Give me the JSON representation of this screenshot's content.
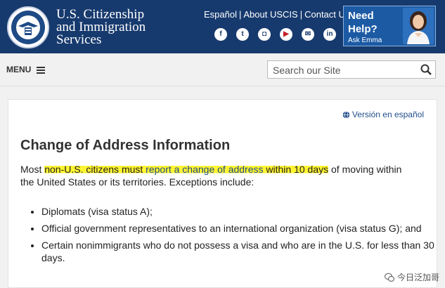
{
  "header": {
    "agency_lines": [
      "U.S. Citizenship",
      "and Immigration",
      "Services"
    ],
    "top_links": [
      "Español",
      "About USCIS",
      "Contact Us"
    ],
    "social_icons": [
      "facebook-icon",
      "twitter-icon",
      "instagram-icon",
      "youtube-icon",
      "email-icon",
      "linkedin-icon"
    ],
    "need_help": {
      "line1": "Need",
      "line2": "Help?",
      "line3": "Ask Emma"
    },
    "colors": {
      "navy": "#173a6e",
      "help_blue": "#1c5aa4"
    }
  },
  "menubar": {
    "menu_label": "MENU",
    "search_placeholder": "Search our Site"
  },
  "content": {
    "spanish_link": "Versión en español",
    "title": "Change of Address Information",
    "intro": {
      "part1": "Most ",
      "hl1": "non-U.S. citizens must ",
      "hl_link": "report a change of address",
      "hl2": " within 10 days",
      "part2": " of moving within the United States or its territories. Exceptions include:"
    },
    "exceptions": [
      "Diplomats (visa status A);",
      "Official government representatives to an international organization (visa status G); and",
      "Certain nonimmigrants who do not possess a visa and who are in the U.S. for less than 30 days."
    ],
    "highlight_color": "#fff430"
  },
  "watermark": "今日泛加哥"
}
